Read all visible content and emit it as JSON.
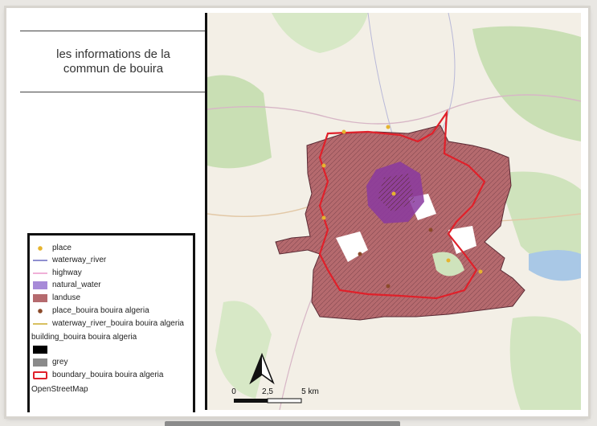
{
  "layout_title": "les informations de la commun de bouira",
  "legend": {
    "items": [
      {
        "label": "place",
        "symbol": "dot",
        "color": "#e6b42e"
      },
      {
        "label": "waterway_river",
        "symbol": "line",
        "color": "#8f8fd0"
      },
      {
        "label": "highway",
        "symbol": "line",
        "color": "#f0b0d8"
      },
      {
        "label": "natural_water",
        "symbol": "fill",
        "color": "#a78ad8"
      },
      {
        "label": "landuse",
        "symbol": "fill",
        "color": "#b56a6e"
      },
      {
        "label": "place_bouira bouira algeria",
        "symbol": "dot",
        "color": "#8b4a2a"
      },
      {
        "label": "waterway_river_bouira bouira algeria",
        "symbol": "line",
        "color": "#d8c060"
      },
      {
        "label": "building_bouira bouira algeria",
        "symbol": "none",
        "color": "#000000"
      },
      {
        "label": "",
        "symbol": "fill",
        "color": "#000000"
      },
      {
        "label": "grey",
        "symbol": "fill",
        "color": "#8a8a8a"
      },
      {
        "label": "boundary_bouira bouira algeria",
        "symbol": "outline",
        "color": "#e0202a"
      },
      {
        "label": "OpenStreetMap",
        "symbol": "none",
        "color": ""
      }
    ]
  },
  "scale_bar": {
    "labels": [
      "0",
      "2,5",
      "5 km"
    ]
  },
  "colors": {
    "landuse": "#b56a6e",
    "boundary": "#e0202a",
    "urban": "#8a3aa0",
    "map_bg": "#f3efe6"
  }
}
